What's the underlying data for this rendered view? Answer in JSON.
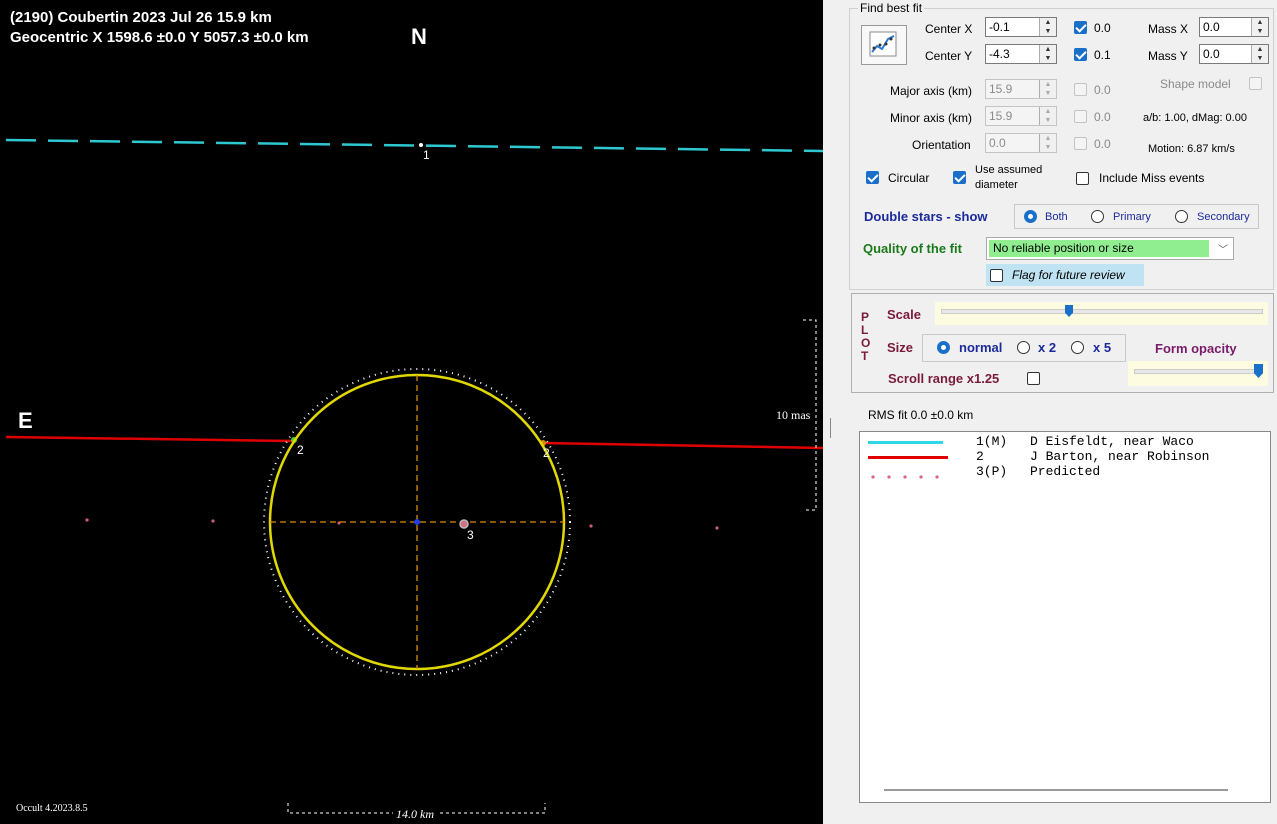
{
  "plot": {
    "title_line1": "(2190) Coubertin  2023 Jul 26   15.9 km",
    "title_line2": "Geocentric  X  1598.6 ±0.0  Y 5057.3 ±0.0 km",
    "north_label": "N",
    "east_label": "E",
    "version": "Occult 4.2023.8.5",
    "scale_vertical": "10 mas",
    "scale_horizontal": "14.0 km",
    "chord_labels": [
      "1",
      "2",
      "2",
      "3"
    ],
    "colors": {
      "chord1": "#2ec8d0",
      "chord2": "#e00000",
      "ellipse": "#e0d800",
      "axes": "#e08a00",
      "predicted": "#d05a7a"
    }
  },
  "fit": {
    "title": "Find best fit",
    "center_x_label": "Center X",
    "center_x": "-0.1",
    "center_x_check": "0.0",
    "center_y_label": "Center Y",
    "center_y": "-4.3",
    "center_y_check": "0.1",
    "mass_x_label": "Mass X",
    "mass_x": "0.0",
    "mass_y_label": "Mass Y",
    "mass_y": "0.0",
    "shape_model_label": "Shape model",
    "major_label": "Major axis (km)",
    "major": "15.9",
    "major_check": "0.0",
    "minor_label": "Minor axis (km)",
    "minor": "15.9",
    "minor_check": "0.0",
    "orient_label": "Orientation",
    "orient": "0.0",
    "orient_check": "0.0",
    "ab_text": "a/b: 1.00, dMag: 0.00",
    "motion_text": "Motion: 6.87 km/s",
    "circular_label": "Circular",
    "assumed_label_1": "Use assumed",
    "assumed_label_2": "diameter",
    "miss_label": "Include Miss events",
    "double_label": "Double stars - show",
    "both_label": "Both",
    "primary_label": "Primary",
    "secondary_label": "Secondary",
    "quality_label": "Quality of the fit",
    "quality_value": "No reliable position or size",
    "flag_label": "Flag for future review"
  },
  "plotctl": {
    "plot_letters": [
      "P",
      "L",
      "O",
      "T"
    ],
    "scale_label": "Scale",
    "size_label": "Size",
    "normal_label": "normal",
    "x2_label": "x 2",
    "x5_label": "x 5",
    "opacity_label": "Form opacity",
    "scroll_label": "Scroll range x1.25"
  },
  "rms": {
    "text": "RMS fit 0.0 ±0.0 km"
  },
  "legend": [
    {
      "num": "1(M)",
      "text": "D Eisfeldt, near Waco",
      "color": "#2ed8e8"
    },
    {
      "num": "2   ",
      "text": "J Barton, near Robinson",
      "color": "#e00000"
    },
    {
      "num": "3(P)",
      "text": "Predicted",
      "color": "#e26090"
    }
  ]
}
